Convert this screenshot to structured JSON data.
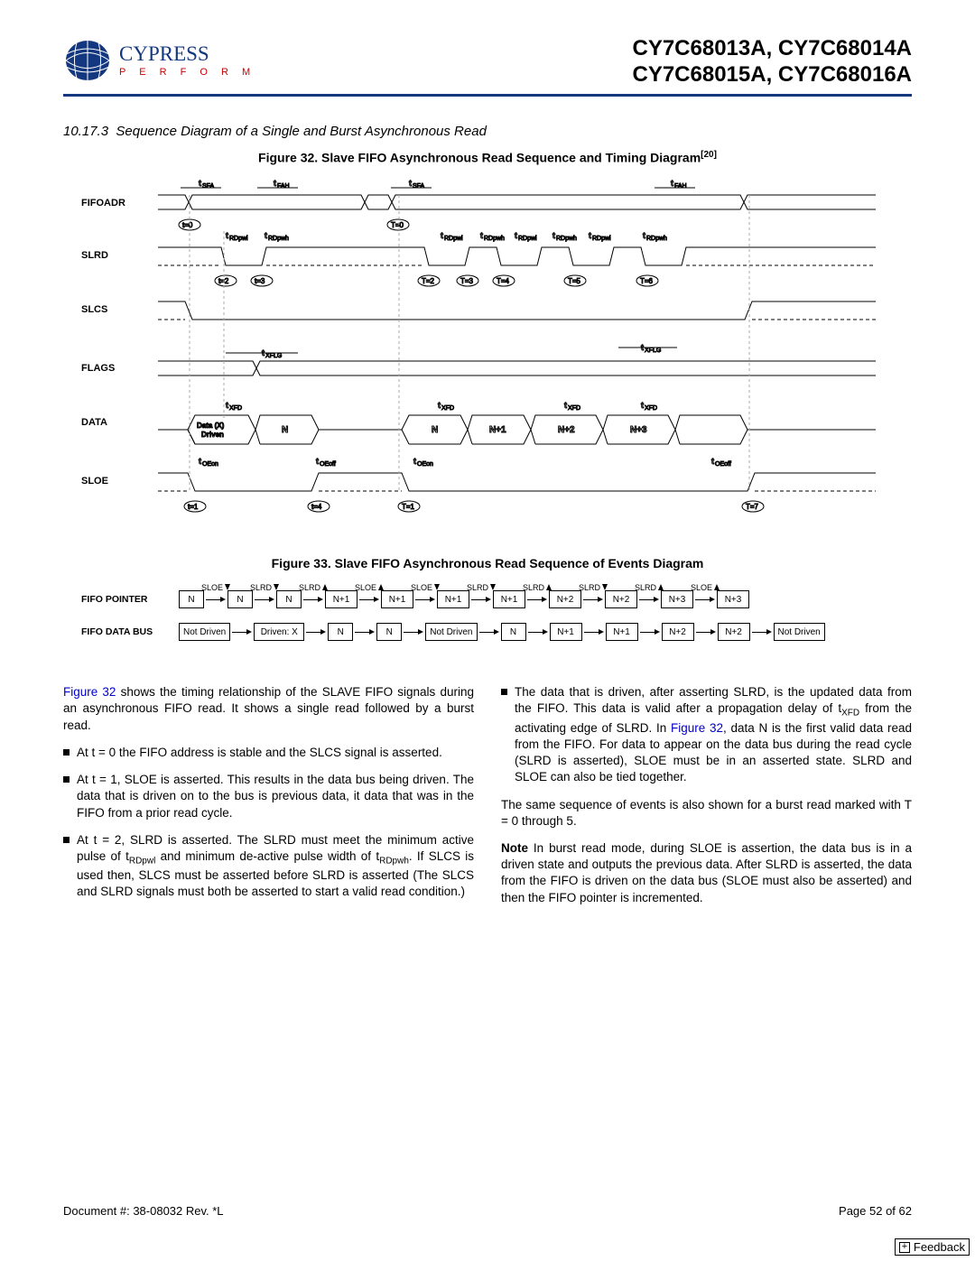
{
  "header": {
    "logo_name": "CYPRESS",
    "logo_tagline": "P E R F O R M",
    "parts_line1": "CY7C68013A, CY7C68014A",
    "parts_line2": "CY7C68015A, CY7C68016A"
  },
  "section": {
    "number": "10.17.3",
    "title": "Sequence Diagram of a Single and Burst Asynchronous Read"
  },
  "fig32": {
    "caption": "Figure 32.  Slave FIFO Asynchronous Read Sequence and Timing Diagram",
    "footnote": "[20]",
    "signals": [
      "FIFOADR",
      "SLRD",
      "SLCS",
      "FLAGS",
      "DATA",
      "SLOE"
    ],
    "timing_labels": {
      "tSFA": "tSFA",
      "tFAH": "tFAH",
      "tRDpwl": "tRDpwl",
      "tRDpwh": "tRDpwh",
      "tXFLG": "tXFLG",
      "tXFD": "tXFD",
      "tOEon": "tOEon",
      "tOEoff": "tOEoff"
    },
    "t_markers": [
      "t=0",
      "t=1",
      "t=2",
      "t=3",
      "t=4",
      "T=0",
      "T=1",
      "T=2",
      "T=3",
      "T=4",
      "T=5",
      "T=6",
      "T=7"
    ],
    "data_labels": [
      "Data (X) Driven",
      "N",
      "N",
      "N+1",
      "N+2",
      "N+3"
    ]
  },
  "fig33": {
    "caption": "Figure 33.  Slave FIFO Asynchronous Read Sequence of Events Diagram",
    "top_labels": [
      "SLOE",
      "SLRD",
      "SLRD",
      "SLOE",
      "SLOE",
      "SLRD",
      "SLRD",
      "SLRD",
      "SLRD",
      "SLOE"
    ],
    "top_dirs": [
      "down",
      "down",
      "up",
      "up",
      "down",
      "down",
      "up",
      "down",
      "up",
      "up"
    ],
    "rows": [
      {
        "label": "FIFO POINTER",
        "boxes": [
          "N",
          "N",
          "N",
          "N+1",
          "N+1",
          "N+1",
          "N+1",
          "N+2",
          "N+2",
          "N+3",
          "N+3"
        ]
      },
      {
        "label": "FIFO DATA BUS",
        "boxes": [
          "Not Driven",
          "Driven: X",
          "N",
          "N",
          "Not Driven",
          "N",
          "N+1",
          "N+1",
          "N+2",
          "N+2",
          "Not Driven"
        ]
      }
    ]
  },
  "body": {
    "left": {
      "intro_pre": "Figure 32",
      "intro_post": " shows the timing relationship of the SLAVE FIFO signals during an asynchronous FIFO read. It shows a single read followed by a burst read.",
      "b1": "At t = 0 the FIFO address is stable and the SLCS signal is asserted.",
      "b2": "At t = 1, SLOE is asserted. This results in the data bus being driven. The data that is driven on to the bus is previous data, it data that was in the FIFO from a prior read cycle.",
      "b3_pre": "At t = 2, SLRD is asserted. The SLRD must meet the minimum active pulse of t",
      "b3_sub1": "RDpwl",
      "b3_mid": " and minimum de-active pulse width of t",
      "b3_sub2": "RDpwh",
      "b3_post": ". If SLCS is used then, SLCS must be asserted before SLRD is asserted (The SLCS and SLRD signals must both be asserted to start a valid read condition.)"
    },
    "right": {
      "b1_pre": "The data that is driven, after asserting SLRD, is the updated data from the FIFO. This data is valid after a propagation delay of t",
      "b1_sub": "XFD",
      "b1_mid": " from the activating edge of SLRD. In ",
      "b1_link": "Figure 32",
      "b1_post": ", data N is the first valid data read from the FIFO. For data to appear on the data bus during the read cycle (SLRD is asserted), SLOE must be in an asserted state. SLRD and SLOE can also be tied together.",
      "p2": "The same sequence of events is also shown for a burst read marked with T = 0 through 5.",
      "p3_pre": "Note",
      "p3_post": " In burst read mode, during SLOE is assertion, the data bus is in a driven state and outputs the previous data. After SLRD is asserted, the data from the FIFO is driven on the data bus (SLOE must also be asserted) and then the FIFO pointer is incremented."
    }
  },
  "footer": {
    "doc": "Document #: 38-08032 Rev. *L",
    "page": "Page 52 of 62",
    "feedback": "Feedback"
  }
}
